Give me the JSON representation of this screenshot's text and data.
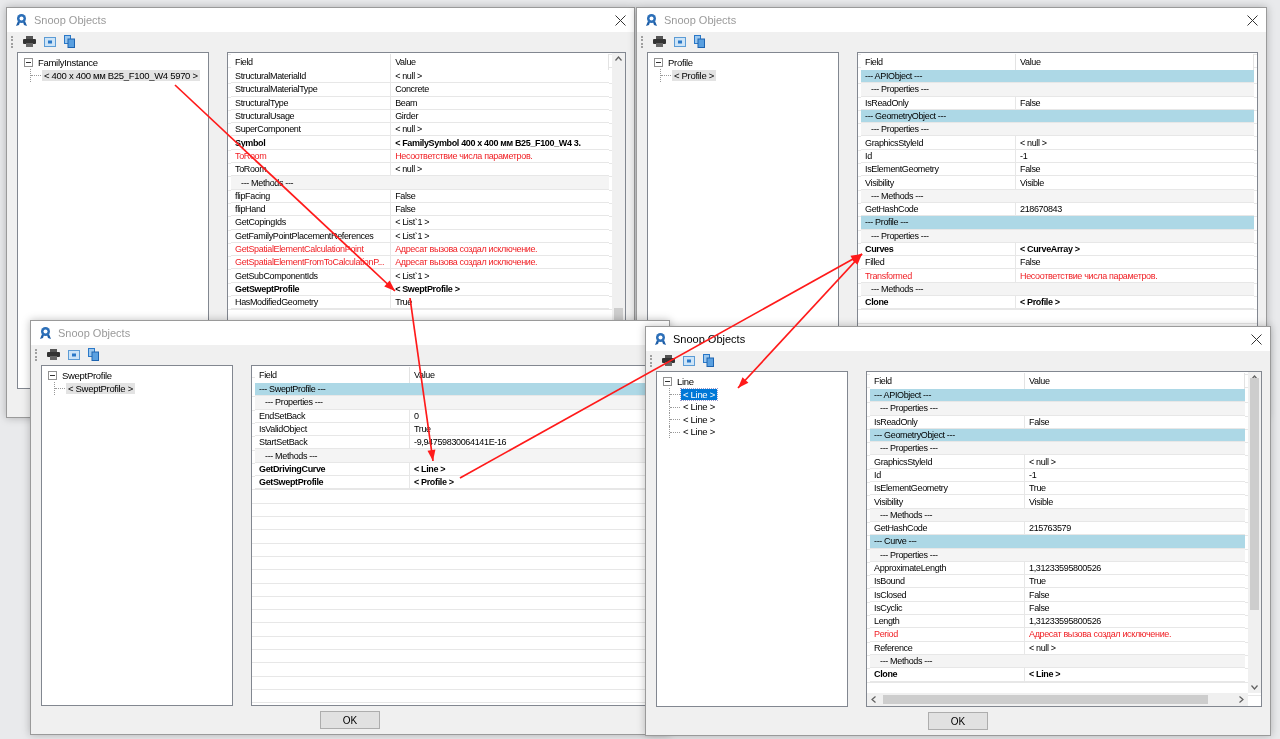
{
  "windows": [
    {
      "title": "Snoop Objects",
      "active": false,
      "close": true,
      "tree": {
        "label": "FamilyInstance",
        "expanded": true,
        "children": [
          {
            "label": "< 400 x 400 мм B25_F100_W4  5970 >",
            "selected": true
          }
        ]
      },
      "columns": [
        "Field",
        "Value"
      ],
      "rows": [
        {
          "kind": "prop",
          "field": "StructuralMaterialId",
          "value": "< null >"
        },
        {
          "kind": "prop",
          "field": "StructuralMaterialType",
          "value": "Concrete"
        },
        {
          "kind": "prop",
          "field": "StructuralType",
          "value": "Beam"
        },
        {
          "kind": "prop",
          "field": "StructuralUsage",
          "value": "Girder"
        },
        {
          "kind": "prop",
          "field": "SuperComponent",
          "value": "< null >"
        },
        {
          "kind": "object",
          "field": "Symbol",
          "value": "< FamilySymbol  400 x 400 мм B25_F100_W4  3."
        },
        {
          "kind": "error",
          "field": "ToRoom",
          "value": "Несоответствие числа параметров."
        },
        {
          "kind": "prop",
          "field": "ToRoom",
          "value": "< null >"
        },
        {
          "kind": "group",
          "label": "--- Methods ---"
        },
        {
          "kind": "prop",
          "field": "flipFacing",
          "value": "False"
        },
        {
          "kind": "prop",
          "field": "flipHand",
          "value": "False"
        },
        {
          "kind": "prop",
          "field": "GetCopingIds",
          "value": "< List`1 >"
        },
        {
          "kind": "prop",
          "field": "GetFamilyPointPlacementReferences",
          "value": "< List`1 >"
        },
        {
          "kind": "error",
          "field": "GetSpatialElementCalculationPoint",
          "value": "Адресат вызова создал исключение."
        },
        {
          "kind": "error",
          "field": "GetSpatialElementFromToCalculationP...",
          "value": "Адресат вызова создал исключение."
        },
        {
          "kind": "prop",
          "field": "GetSubComponentIds",
          "value": "< List`1 >"
        },
        {
          "kind": "object",
          "field": "GetSweptProfile",
          "value": "< SweptProfile >"
        },
        {
          "kind": "prop",
          "field": "HasModifiedGeometry",
          "value": "True"
        }
      ]
    },
    {
      "title": "Snoop Objects",
      "active": false,
      "close": true,
      "tree": {
        "label": "Profile",
        "expanded": true,
        "children": [
          {
            "label": "< Profile >",
            "selected": true
          }
        ]
      },
      "columns": [
        "Field",
        "Value"
      ],
      "rows": [
        {
          "kind": "section",
          "label": "--- APIObject ---"
        },
        {
          "kind": "group",
          "label": "--- Properties ---"
        },
        {
          "kind": "prop",
          "field": "IsReadOnly",
          "value": "False"
        },
        {
          "kind": "section",
          "label": "--- GeometryObject ---"
        },
        {
          "kind": "group",
          "label": "--- Properties ---"
        },
        {
          "kind": "prop",
          "field": "GraphicsStyleId",
          "value": "< null >"
        },
        {
          "kind": "prop",
          "field": "Id",
          "value": "-1"
        },
        {
          "kind": "prop",
          "field": "IsElementGeometry",
          "value": "False"
        },
        {
          "kind": "prop",
          "field": "Visibility",
          "value": "Visible"
        },
        {
          "kind": "group",
          "label": "--- Methods ---"
        },
        {
          "kind": "prop",
          "field": "GetHashCode",
          "value": "218670843"
        },
        {
          "kind": "section",
          "label": "--- Profile ---"
        },
        {
          "kind": "group",
          "label": "--- Properties ---"
        },
        {
          "kind": "object",
          "field": "Curves",
          "value": "< CurveArray >"
        },
        {
          "kind": "prop",
          "field": "Filled",
          "value": "False"
        },
        {
          "kind": "error",
          "field": "Transformed",
          "value": "Несоответствие числа параметров."
        },
        {
          "kind": "group",
          "label": "--- Methods ---"
        },
        {
          "kind": "object",
          "field": "Clone",
          "value": "< Profile >"
        }
      ]
    },
    {
      "title": "Snoop Objects",
      "active": false,
      "close": false,
      "tree": {
        "label": "SweptProfile",
        "expanded": true,
        "children": [
          {
            "label": "< SweptProfile >",
            "selected": true
          }
        ]
      },
      "columns": [
        "Field",
        "Value"
      ],
      "rows": [
        {
          "kind": "section",
          "label": "--- SweptProfile ---"
        },
        {
          "kind": "group",
          "label": "--- Properties ---"
        },
        {
          "kind": "prop",
          "field": "EndSetBack",
          "value": "0"
        },
        {
          "kind": "prop",
          "field": "IsValidObject",
          "value": "True"
        },
        {
          "kind": "prop",
          "field": "StartSetBack",
          "value": "-9,94759830064141E-16"
        },
        {
          "kind": "group",
          "label": "--- Methods ---"
        },
        {
          "kind": "object",
          "field": "GetDrivingCurve",
          "value": "< Line >"
        },
        {
          "kind": "object",
          "field": "GetSweptProfile",
          "value": "< Profile >"
        }
      ],
      "ok_button": "OK"
    },
    {
      "title": "Snoop Objects",
      "active": true,
      "close": true,
      "tree": {
        "label": "Line",
        "expanded": true,
        "children": [
          {
            "label": "< Line >",
            "selected": true
          },
          {
            "label": "< Line >",
            "selected": false
          },
          {
            "label": "< Line >",
            "selected": false
          },
          {
            "label": "< Line >",
            "selected": false
          }
        ]
      },
      "columns": [
        "Field",
        "Value"
      ],
      "rows": [
        {
          "kind": "section",
          "label": "--- APIObject ---"
        },
        {
          "kind": "group",
          "label": "--- Properties ---"
        },
        {
          "kind": "prop",
          "field": "IsReadOnly",
          "value": "False"
        },
        {
          "kind": "section",
          "label": "--- GeometryObject ---"
        },
        {
          "kind": "group",
          "label": "--- Properties ---"
        },
        {
          "kind": "prop",
          "field": "GraphicsStyleId",
          "value": "< null >"
        },
        {
          "kind": "prop",
          "field": "Id",
          "value": "-1"
        },
        {
          "kind": "prop",
          "field": "IsElementGeometry",
          "value": "True"
        },
        {
          "kind": "prop",
          "field": "Visibility",
          "value": "Visible"
        },
        {
          "kind": "group",
          "label": "--- Methods ---"
        },
        {
          "kind": "prop",
          "field": "GetHashCode",
          "value": "215763579"
        },
        {
          "kind": "section",
          "label": "--- Curve ---"
        },
        {
          "kind": "group",
          "label": "--- Properties ---"
        },
        {
          "kind": "prop",
          "field": "ApproximateLength",
          "value": "1,31233595800526"
        },
        {
          "kind": "prop",
          "field": "IsBound",
          "value": "True"
        },
        {
          "kind": "prop",
          "field": "IsClosed",
          "value": "False"
        },
        {
          "kind": "prop",
          "field": "IsCyclic",
          "value": "False"
        },
        {
          "kind": "prop",
          "field": "Length",
          "value": "1,31233595800526"
        },
        {
          "kind": "error",
          "field": "Period",
          "value": "Адресат вызова создал исключение."
        },
        {
          "kind": "prop",
          "field": "Reference",
          "value": "< null >"
        },
        {
          "kind": "group",
          "label": "--- Methods ---"
        },
        {
          "kind": "object",
          "field": "Clone",
          "value": "< Line >"
        }
      ],
      "ok_button": "OK"
    }
  ]
}
